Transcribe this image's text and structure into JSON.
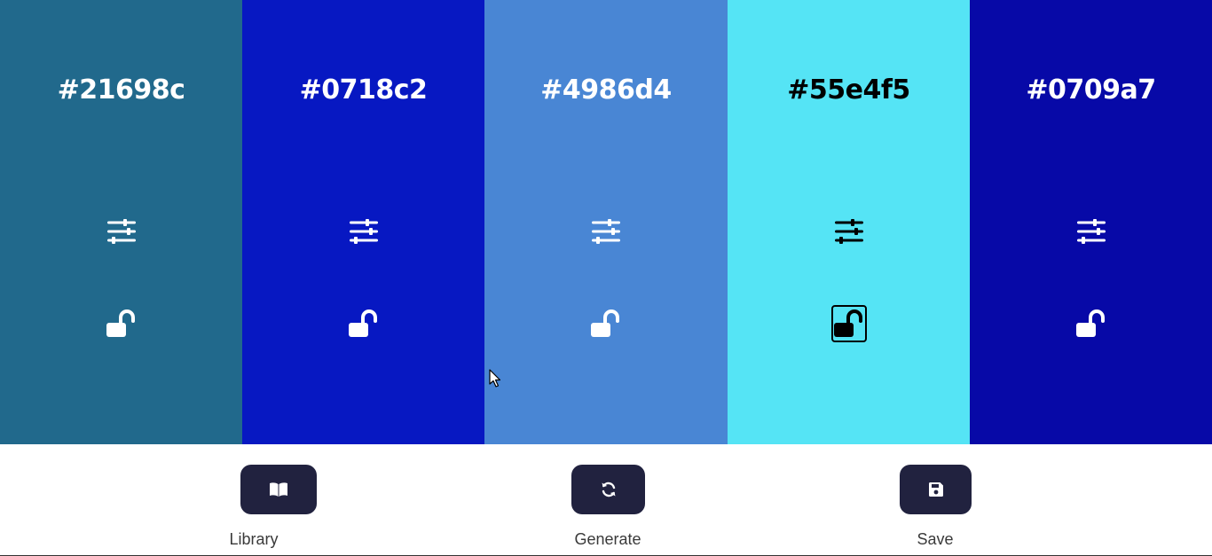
{
  "palette": {
    "colors": [
      {
        "hex": "#21698c",
        "text_color": "#ffffff",
        "locked": false
      },
      {
        "hex": "#0718c2",
        "text_color": "#ffffff",
        "locked": false
      },
      {
        "hex": "#4986d4",
        "text_color": "#ffffff",
        "locked": false
      },
      {
        "hex": "#55e4f5",
        "text_color": "#000000",
        "locked": true
      },
      {
        "hex": "#0709a7",
        "text_color": "#ffffff",
        "locked": false
      }
    ],
    "adjust_icon": "sliders-icon",
    "lock_icon": "unlock-icon"
  },
  "controls": {
    "library_label": "Library",
    "library_icon": "book-open-icon",
    "generate_label": "Generate",
    "generate_icon": "refresh-icon",
    "save_label": "Save",
    "save_icon": "floppy-disk-icon",
    "button_color": "#21223f"
  }
}
